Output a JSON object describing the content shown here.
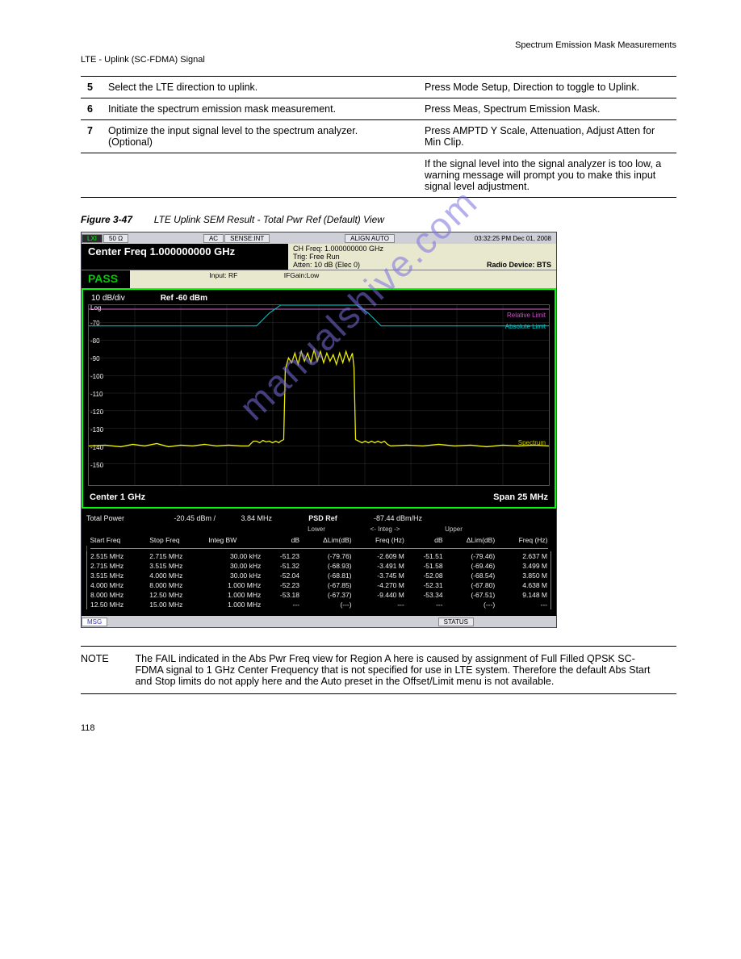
{
  "header": {
    "right": "Spectrum Emission Mask Measurements",
    "left": "LTE - Uplink (SC-FDMA) Signal"
  },
  "steps": [
    {
      "n": "5",
      "rows": [
        {
          "action": "Select the LTE direction to uplink.",
          "notes": "Press Mode Setup, Direction to toggle to Uplink."
        }
      ]
    },
    {
      "n": "6",
      "rows": [
        {
          "action": "Initiate the spectrum emission mask measurement.",
          "notes": "Press Meas, Spectrum Emission Mask."
        }
      ]
    },
    {
      "n": "7",
      "rows": [
        {
          "action": "Optimize the input signal level to the spectrum analyzer. (Optional)",
          "notes": "Press AMPTD Y Scale, Attenuation, Adjust Atten for Min Clip."
        },
        {
          "action": "",
          "notes": "If the signal level into the signal analyzer is too low, a warning message will prompt you to make this input signal level adjustment."
        }
      ]
    }
  ],
  "caption_prefix": "Figure 3-47",
  "caption_body": "LTE Uplink SEM Result - Total Pwr Ref  (Default) View",
  "screenshot": {
    "topbar": {
      "lxi": "LXI",
      "ohm": "50 Ω",
      "ac": "AC",
      "sense": "SENSE:INT",
      "align": "ALIGN AUTO",
      "ts": "03:32:25 PM Dec 01, 2008"
    },
    "center_freq": "Center Freq  1.000000000 GHz",
    "mid": {
      "chfreq": "CH Freq: 1.000000000 GHz",
      "trig": "Trig: Free Run",
      "atten": "Atten: 10 dB (Elec 0)",
      "rdev": "Radio Device: BTS"
    },
    "pass": "PASS",
    "pass_info": {
      "input": "Input: RF",
      "ifg": "IFGain:Low"
    },
    "plot": {
      "scale": "10 dB/div",
      "ref": "Ref  -60 dBm",
      "log": "Log",
      "yticks": [
        "-70",
        "-80",
        "-90",
        "-100",
        "-110",
        "-120",
        "-130",
        "-140",
        "-150"
      ],
      "abslim": "Absolute Limit",
      "rellim": "Relative Limit",
      "spectrum": "Spectrum",
      "center": "Center  1 GHz",
      "span": "Span 25 MHz"
    },
    "results": {
      "tp_label": "Total Power",
      "tp_val": "-20.45 dBm /",
      "tp_bw": "3.84 MHz",
      "psd_label": "PSD Ref",
      "psd_val": "-87.44 dBm/Hz",
      "lower_lbl": "Lower",
      "integ_lbl": "<- Integ ->",
      "upper_lbl": "Upper",
      "cols": [
        "Start Freq",
        "Stop Freq",
        "Integ BW",
        "dB",
        "ΔLim(dB)",
        "Freq (Hz)",
        "dB",
        "ΔLim(dB)",
        "Freq (Hz)"
      ],
      "rows": [
        [
          "2.515 MHz",
          "2.715 MHz",
          "30.00 kHz",
          "-51.23",
          "(-79.76)",
          "-2.609 M",
          "-51.51",
          "(-79.46)",
          "2.637 M"
        ],
        [
          "2.715 MHz",
          "3.515 MHz",
          "30.00 kHz",
          "-51.32",
          "(-68.93)",
          "-3.491 M",
          "-51.58",
          "(-69.46)",
          "3.499 M"
        ],
        [
          "3.515 MHz",
          "4.000 MHz",
          "30.00 kHz",
          "-52.04",
          "(-68.81)",
          "-3.745 M",
          "-52.08",
          "(-68.54)",
          "3.850 M"
        ],
        [
          "4.000 MHz",
          "8.000 MHz",
          "1.000 MHz",
          "-52.23",
          "(-67.85)",
          "-4.270 M",
          "-52.31",
          "(-67.80)",
          "4.638 M"
        ],
        [
          "8.000 MHz",
          "12.50 MHz",
          "1.000 MHz",
          "-53.18",
          "(-67.37)",
          "-9.440 M",
          "-53.34",
          "(-67.51)",
          "9.148 M"
        ],
        [
          "12.50 MHz",
          "15.00 MHz",
          "1.000 MHz",
          "---",
          "(---)",
          "---",
          "---",
          "(---)",
          "---"
        ]
      ]
    },
    "msgbar": {
      "msg": "MSG",
      "status": "STATUS"
    }
  },
  "note": {
    "label": "NOTE",
    "text": "The FAIL indicated in the Abs Pwr Freq view for Region A here is caused by assignment of Full Filled QPSK SC-FDMA signal to 1 GHz Center Frequency that is not specified for use in LTE system. Therefore the default Abs Start and Stop limits do not apply here and the Auto preset in the Offset/Limit menu is not available."
  },
  "watermark": "manualshive.com",
  "pagenum": "118"
}
